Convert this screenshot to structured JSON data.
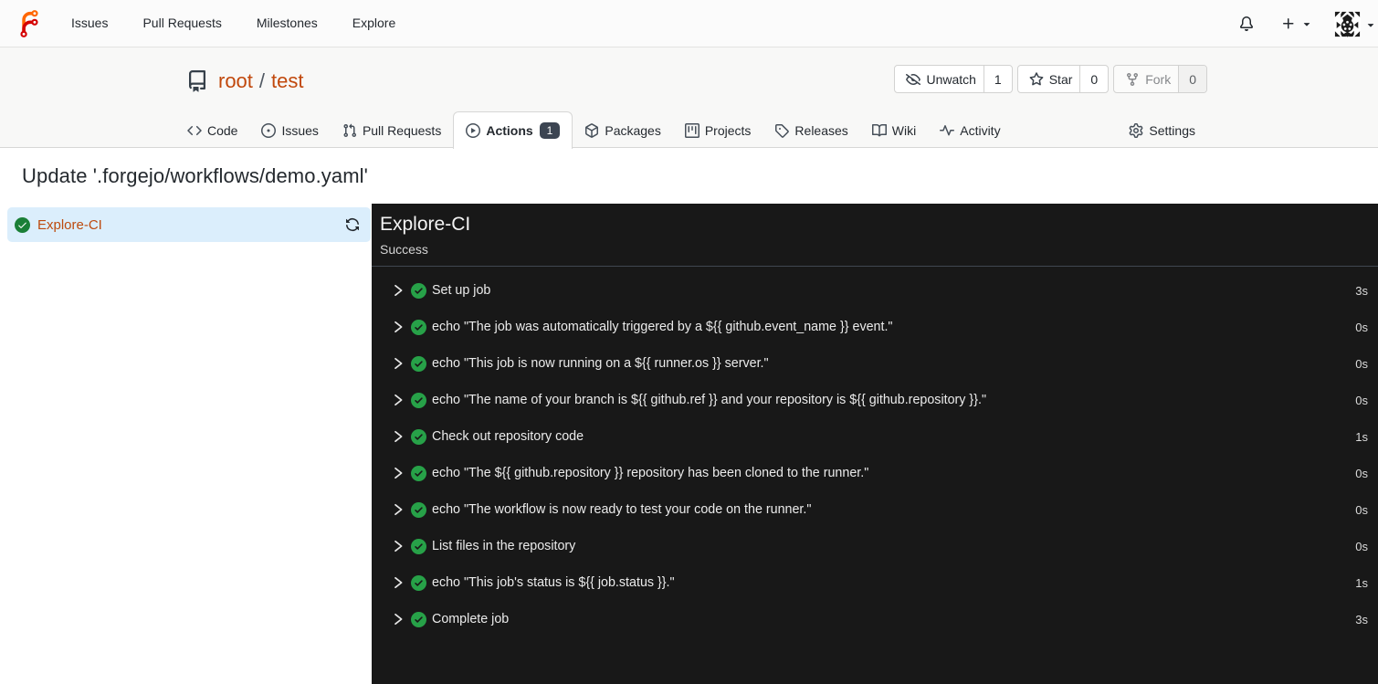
{
  "colors": {
    "primary_link": "#c1480c",
    "selected_job_bg": "#dbeefc",
    "success_green_light": "#1a7f37",
    "success_green_dark": "#27a148",
    "panel_bg": "#181818",
    "tab_badge_bg": "#3c4552",
    "header_bg": "#f8f8f7"
  },
  "navbar": {
    "logo": "forgejo-logo",
    "items": [
      "Issues",
      "Pull Requests",
      "Milestones",
      "Explore"
    ],
    "right": [
      "notifications-bell",
      "create-new-plus",
      "user-avatar"
    ]
  },
  "repo": {
    "owner": "root",
    "separator": "/",
    "name": "test",
    "buttons": {
      "watch": {
        "label": "Unwatch",
        "count": "1"
      },
      "star": {
        "label": "Star",
        "count": "0"
      },
      "fork": {
        "label": "Fork",
        "count": "0"
      }
    }
  },
  "tabs": [
    {
      "label": "Code"
    },
    {
      "label": "Issues"
    },
    {
      "label": "Pull Requests"
    },
    {
      "label": "Actions",
      "badge": "1",
      "active": true
    },
    {
      "label": "Packages"
    },
    {
      "label": "Projects"
    },
    {
      "label": "Releases"
    },
    {
      "label": "Wiki"
    },
    {
      "label": "Activity"
    },
    {
      "label": "Settings"
    }
  ],
  "run": {
    "title": "Update '.forgejo/workflows/demo.yaml'",
    "job": {
      "name": "Explore-CI"
    },
    "panel": {
      "title": "Explore-CI",
      "status": "Success",
      "steps": [
        {
          "name": "Set up job",
          "duration": "3s"
        },
        {
          "name": "echo \"The job was automatically triggered by a ${{ github.event_name }} event.\"",
          "duration": "0s"
        },
        {
          "name": "echo \"This job is now running on a ${{ runner.os }} server.\"",
          "duration": "0s"
        },
        {
          "name": "echo \"The name of your branch is ${{ github.ref }} and your repository is ${{ github.repository }}.\"",
          "duration": "0s"
        },
        {
          "name": "Check out repository code",
          "duration": "1s"
        },
        {
          "name": "echo \"The ${{ github.repository }} repository has been cloned to the runner.\"",
          "duration": "0s"
        },
        {
          "name": "echo \"The workflow is now ready to test your code on the runner.\"",
          "duration": "0s"
        },
        {
          "name": "List files in the repository",
          "duration": "0s"
        },
        {
          "name": "echo \"This job's status is ${{ job.status }}.\"",
          "duration": "1s"
        },
        {
          "name": "Complete job",
          "duration": "3s"
        }
      ]
    }
  }
}
